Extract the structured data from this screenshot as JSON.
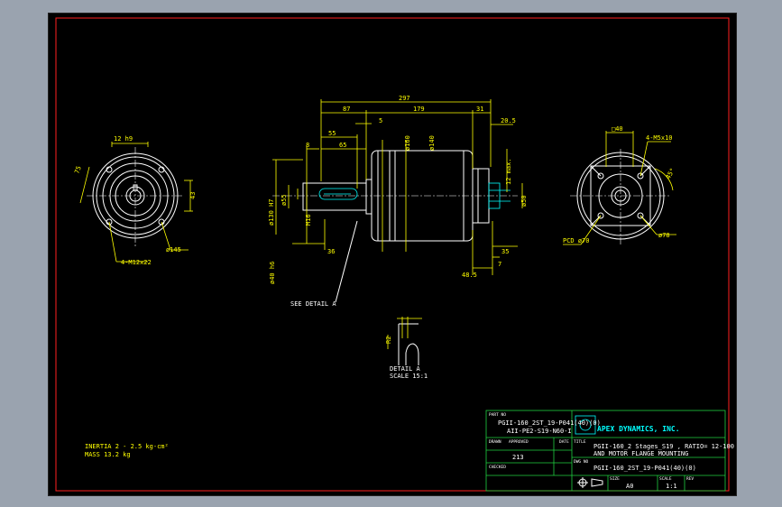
{
  "colors": {
    "background": "#000000",
    "border": "#ff2020",
    "geometry": "#ffffff",
    "dimension": "#ffff00",
    "hidden": "#00ffff",
    "title_block": "#20d040"
  },
  "dimensions": {
    "overall": "297",
    "d87": "87",
    "d179": "179",
    "d31": "31",
    "d20_5": "20.5",
    "d5": "5",
    "d55": "55",
    "d65": "65",
    "d8": "8",
    "d3": "3",
    "dia160": "ø160",
    "dia140": "ø140",
    "dia130h7": "ø130 H7",
    "dia55": "ø55",
    "m16": "M16",
    "dia40": "ø40 h6",
    "d36": "36",
    "d12": "12 max.",
    "dia50": "ø50",
    "d35": "35",
    "d48_5": "48.5",
    "d7": "7",
    "left_key": "12 h9",
    "left_75": "75",
    "left_43": "43",
    "left_dia145": "ø145",
    "left_m12": "4-M12x22",
    "right_sq": "□40",
    "right_m5": "4-M5x10",
    "right_45": "45°",
    "right_pcd": "PCD ø70",
    "right_dia78": "ø78",
    "see_detail": "SEE DETAIL A",
    "detail_r": "R2",
    "detail_label": "DETAIL A",
    "detail_scale": "SCALE 15:1"
  },
  "notes": {
    "inertia": "INERTIA 2 - 2.5 kg-cm²",
    "mass": "MASS 13.2 kg"
  },
  "title_block": {
    "part_no_label": "PART NO",
    "part_no_line1": "PGII-160_2ST_19-P041(40)(0)",
    "part_no_line2": "AII-PE2-S19-N60-I",
    "company": "APEX DYNAMICS, INC.",
    "title_label": "TITLE",
    "title_line1": "PGII-160_2 Stages_S19 , RATIO= 12-100",
    "title_line2": "AND MOTOR FLANGE MOUNTING",
    "drawn_label": "DRAWN",
    "approved_label": "APPROVED",
    "date_label": "DATE",
    "drawn_value": "213",
    "checked_label": "CHECKED",
    "dwg_no_label": "DWG NO",
    "dwg_no_value": "PGII-160_2ST_19-P041(40)(0)",
    "size_label": "SIZE",
    "size_value": "A0",
    "scale_label": "SCALE",
    "scale_value": "1:1",
    "rev_label": "REV"
  }
}
